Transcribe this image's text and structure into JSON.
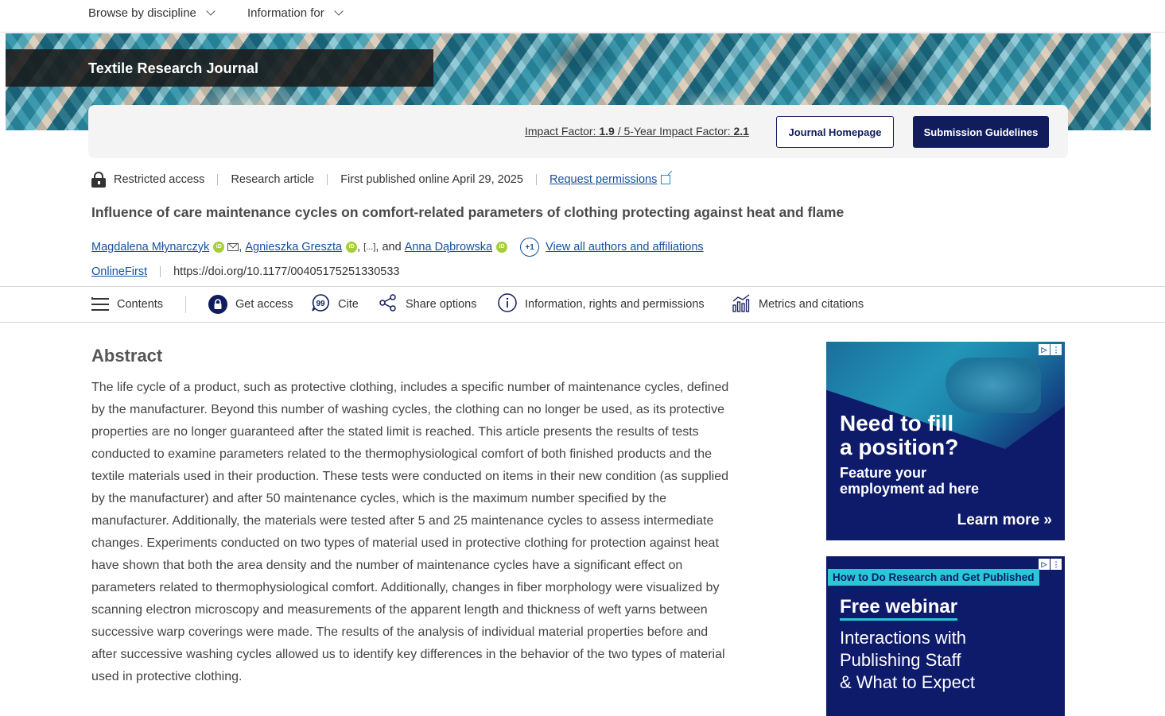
{
  "topnav": {
    "browse_label": "Browse by discipline",
    "info_label": "Information for"
  },
  "journal": {
    "title": "Textile Research Journal",
    "impact_label": "Impact Factor:",
    "impact_value": "1.9",
    "impact_sep": "/",
    "five_year_label": "5-Year Impact Factor:",
    "five_year_value": "2.1",
    "homepage_button": "Journal Homepage",
    "submission_button": "Submission Guidelines"
  },
  "meta": {
    "access": "Restricted access",
    "type": "Research article",
    "published": "First published online April 29, 2025",
    "permissions_link": "Request permissions"
  },
  "article": {
    "title": "Influence of care maintenance cycles on comfort-related parameters of clothing protecting against heat and flame",
    "author1": "Magdalena Młynarczyk",
    "author2": "Agnieszka Greszta",
    "ellipsis": "[...]",
    "and": ", and",
    "author3": "Anna Dąbrowska",
    "more_badge": "+1",
    "view_all": "View all authors and affiliations",
    "issue": "OnlineFirst",
    "doi": "https://doi.org/10.1177/00405175251330533"
  },
  "toolbar": {
    "contents": "Contents",
    "get_access": "Get access",
    "cite": "Cite",
    "share": "Share options",
    "info": "Information, rights and permissions",
    "metrics": "Metrics and citations"
  },
  "abstract": {
    "heading": "Abstract",
    "text": "The life cycle of a product, such as protective clothing, includes a specific number of maintenance cycles, defined by the manufacturer. Beyond this number of washing cycles, the clothing can no longer be used, as its protective properties are no longer guaranteed after the stated limit is reached. This article presents the results of tests conducted to examine parameters related to the thermophysiological comfort of both finished products and the textile materials used in their production. These tests were conducted on items in their new condition (as supplied by the manufacturer) and after 50 maintenance cycles, which is the maximum number specified by the manufacturer. Additionally, the materials were tested after 5 and 25 maintenance cycles to assess intermediate changes. Experiments conducted on two types of material used in protective clothing for protection against heat have shown that both the area density and the number of maintenance cycles have a significant effect on parameters related to thermophysiological comfort. Additionally, changes in fiber morphology were visualized by scanning electron microscopy and measurements of the apparent length and thickness of weft yarns between successive warp coverings were made. The results of the analysis of individual material properties before and after successive washing cycles allowed us to identify key differences in the behavior of the two types of material used in protective clothing."
  },
  "ads": {
    "ad1_line1": "Need to fill",
    "ad1_line2": "a position?",
    "ad1_sub1": "Feature your",
    "ad1_sub2": "employment ad here",
    "ad1_cta": "Learn more",
    "ad1_cta_arrow": "»",
    "ad2_tag": "How to Do Research and Get Published",
    "ad2_title": "Free webinar",
    "ad2_line1": "Interactions with",
    "ad2_line2": "Publishing Staff",
    "ad2_line3": "& What to Expect"
  },
  "colors": {
    "navy": "#101c5c",
    "link": "#1452a0",
    "orcid": "#a6ce39",
    "ad_accent": "#2bc7d4"
  }
}
